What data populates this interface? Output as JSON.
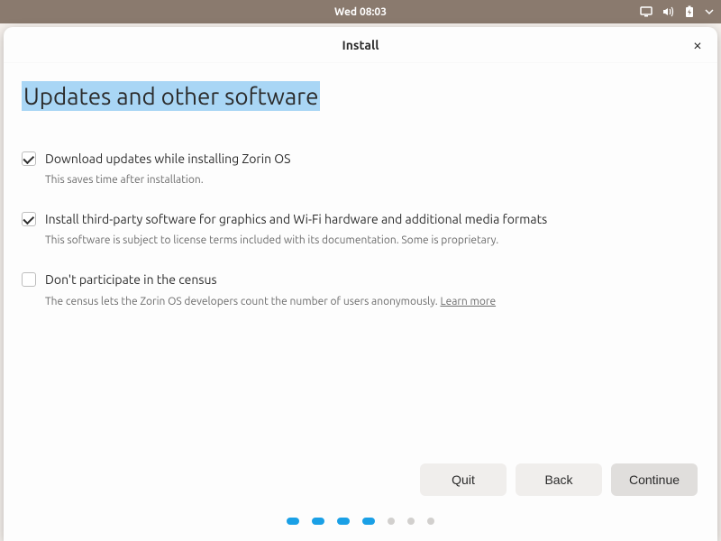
{
  "topbar": {
    "datetime": "Wed 08:03"
  },
  "window": {
    "title": "Install",
    "close_label": "×"
  },
  "page": {
    "heading": "Updates and other software"
  },
  "options": [
    {
      "checked": true,
      "label": "Download updates while installing Zorin OS",
      "desc": "This saves time after installation."
    },
    {
      "checked": true,
      "label": "Install third-party software for graphics and Wi-Fi hardware and additional media formats",
      "desc": "This software is subject to license terms included with its documentation. Some is proprietary."
    },
    {
      "checked": false,
      "label": "Don't participate in the census",
      "desc": "The census lets the Zorin OS developers count the number of users anonymously. ",
      "link": "Learn more"
    }
  ],
  "buttons": {
    "quit": "Quit",
    "back": "Back",
    "continue": "Continue"
  },
  "progress": {
    "total": 7,
    "active": [
      0,
      1,
      2,
      3
    ]
  }
}
